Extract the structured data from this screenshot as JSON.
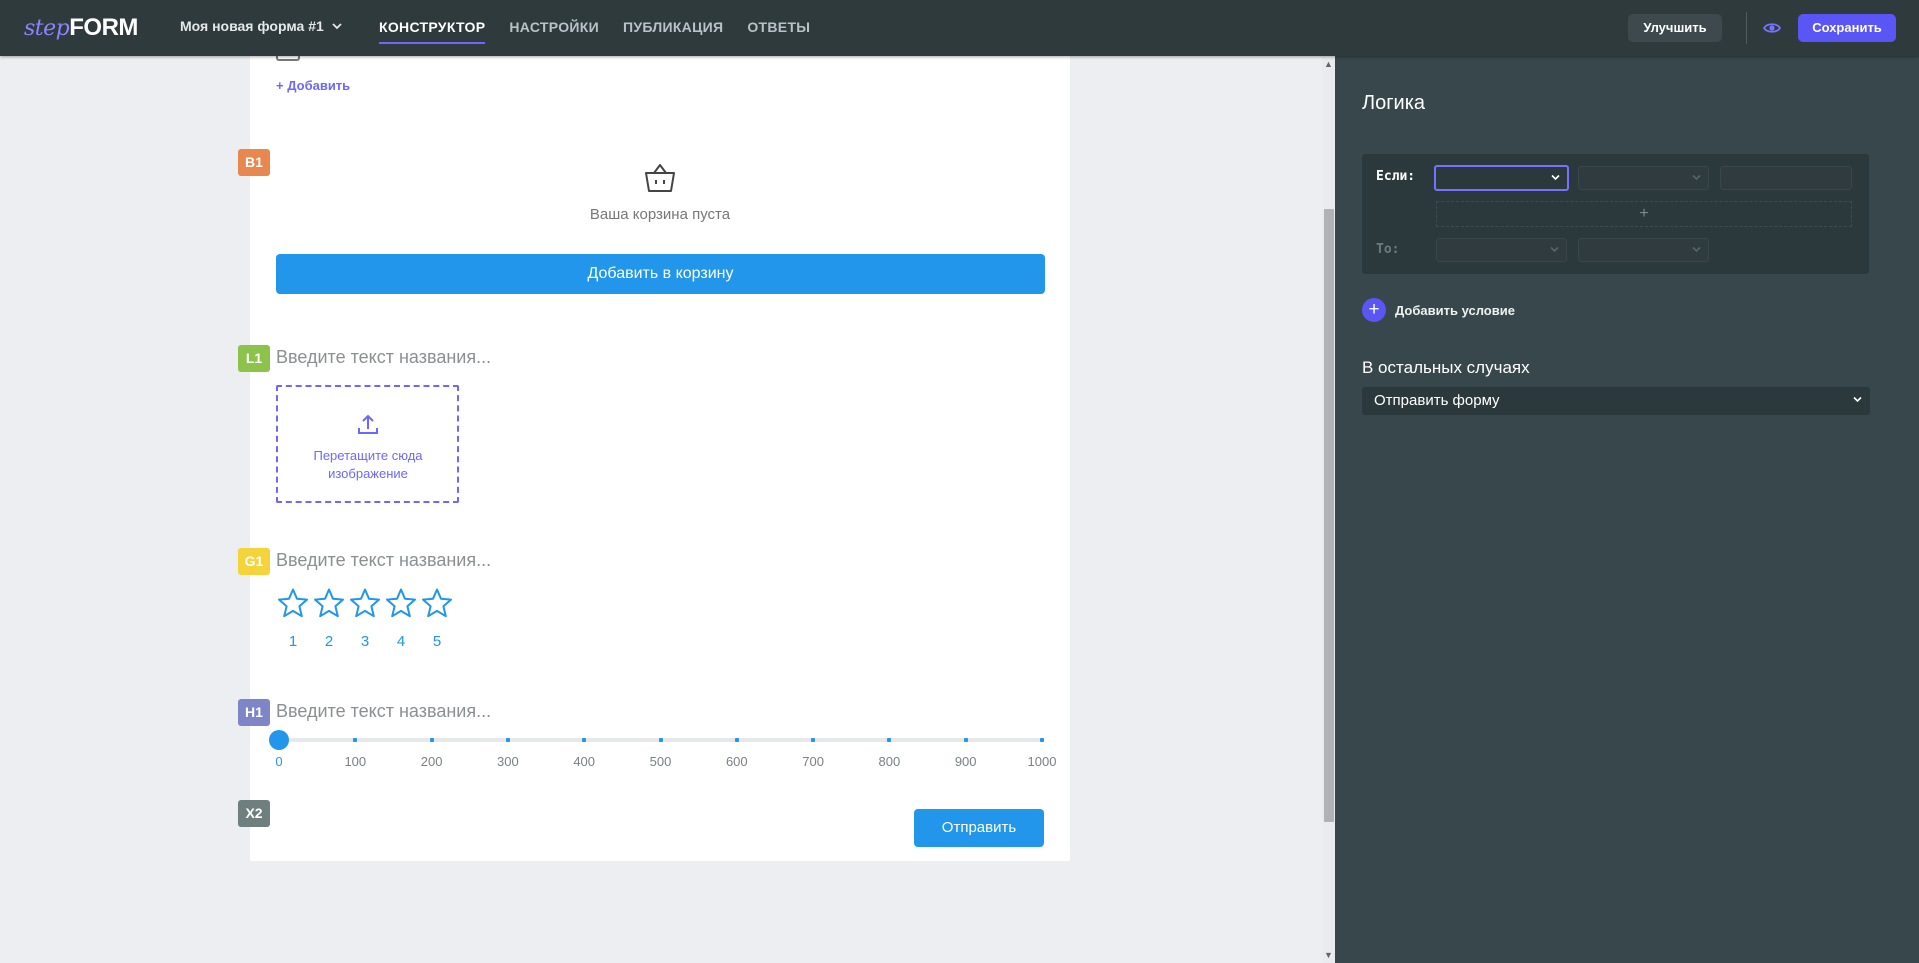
{
  "header": {
    "logo_step": "step",
    "logo_form": "FORM",
    "form_name": "Моя новая форма #1",
    "nav": [
      {
        "label": "КОНСТРУКТОР",
        "active": true
      },
      {
        "label": "НАСТРОЙКИ",
        "active": false
      },
      {
        "label": "ПУБЛИКАЦИЯ",
        "active": false
      },
      {
        "label": "ОТВЕТЫ",
        "active": false
      }
    ],
    "improve_label": "Улучшить",
    "save_label": "Сохранить"
  },
  "form": {
    "add_label": "+ Добавить",
    "blocks": {
      "cart": {
        "badge": "B1",
        "badge_color": "#e8884f",
        "empty_text": "Ваша корзина пуста",
        "button_label": "Добавить в корзину"
      },
      "image": {
        "badge": "L1",
        "badge_color": "#8cc34a",
        "title_placeholder": "Введите текст названия...",
        "dropzone_line1": "Перетащите сюда",
        "dropzone_line2": "изображение"
      },
      "rating": {
        "badge": "G1",
        "badge_color": "#f5d33a",
        "title_placeholder": "Введите текст названия...",
        "stars": [
          "1",
          "2",
          "3",
          "4",
          "5"
        ]
      },
      "slider": {
        "badge": "H1",
        "badge_color": "#7e86c8",
        "title_placeholder": "Введите текст названия...",
        "labels": [
          "0",
          "100",
          "200",
          "300",
          "400",
          "500",
          "600",
          "700",
          "800",
          "900",
          "1000"
        ],
        "value": 0
      },
      "submit": {
        "badge": "X2",
        "badge_color": "#6f7f80",
        "button_label": "Отправить"
      }
    }
  },
  "logic": {
    "title": "Логика",
    "if_label": "Если:",
    "then_label": "То:",
    "add_condition_label": "Добавить условие",
    "else_title": "В остальных случаях",
    "else_value": "Отправить форму"
  },
  "colors": {
    "accent": "#5a55f5",
    "primary_button": "#2196ea",
    "panel_bg": "#37474b",
    "topbar_bg": "#2f3a3d"
  }
}
